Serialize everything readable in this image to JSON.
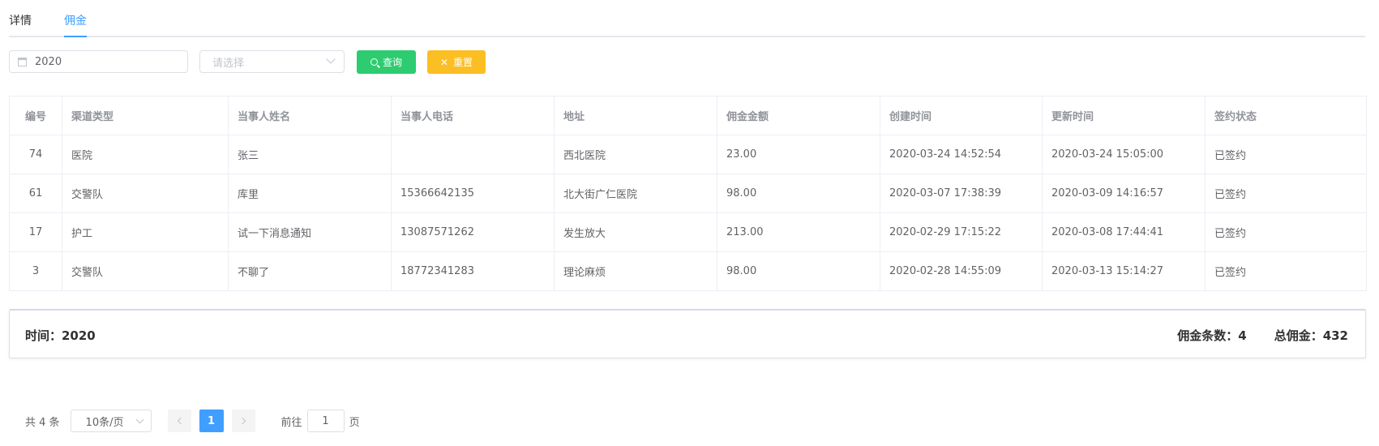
{
  "tabs": [
    {
      "label": "详情",
      "active": false
    },
    {
      "label": "佣金",
      "active": true
    }
  ],
  "filters": {
    "year_value": "2020",
    "select_placeholder": "请选择",
    "search_label": "查询",
    "reset_label": "重置"
  },
  "colors": {
    "accent": "#409eff",
    "search_button": "#2dcc70",
    "reset_button": "#fbbf24"
  },
  "table": {
    "headers": [
      "编号",
      "渠道类型",
      "当事人姓名",
      "当事人电话",
      "地址",
      "佣金金额",
      "创建时间",
      "更新时间",
      "签约状态"
    ],
    "rows": [
      [
        "74",
        "医院",
        "张三",
        "",
        "西北医院",
        "23.00",
        "2020-03-24 14:52:54",
        "2020-03-24 15:05:00",
        "已签约"
      ],
      [
        "61",
        "交警队",
        "库里",
        "15366642135",
        "北大街广仁医院",
        "98.00",
        "2020-03-07 17:38:39",
        "2020-03-09 14:16:57",
        "已签约"
      ],
      [
        "17",
        "护工",
        "试一下消息通知",
        "13087571262",
        "发生放大",
        "213.00",
        "2020-02-29 17:15:22",
        "2020-03-08 17:44:41",
        "已签约"
      ],
      [
        "3",
        "交警队",
        "不聊了",
        "18772341283",
        "理论麻烦",
        "98.00",
        "2020-02-28 14:55:09",
        "2020-03-13 15:14:27",
        "已签约"
      ]
    ]
  },
  "summary": {
    "time_text": "时间：2020",
    "count_text": "佣金条数：4",
    "total_text": "总佣金：432"
  },
  "pagination": {
    "total_text": "共 4 条",
    "page_size": "10条/页",
    "current_page": "1",
    "goto_prefix": "前往",
    "goto_value": "1",
    "goto_suffix": "页"
  }
}
